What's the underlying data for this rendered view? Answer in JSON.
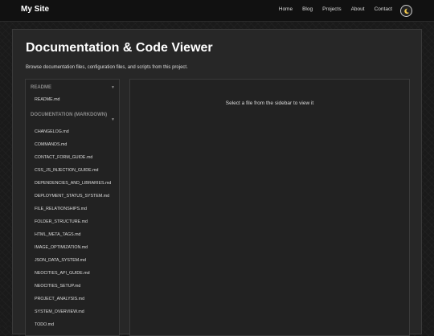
{
  "header": {
    "site_title": "My Site",
    "nav": [
      "Home",
      "Blog",
      "Projects",
      "About",
      "Contact"
    ],
    "theme_icon": "moon-icon"
  },
  "main": {
    "title": "Documentation & Code Viewer",
    "description": "Browse documentation files, configuration files, and scripts from this project."
  },
  "sidebar": {
    "readme_section": {
      "label": "README",
      "files": [
        "README.md"
      ]
    },
    "docs_section": {
      "label": "DOCUMENTATION (MARKDOWN)",
      "files": [
        "CHANGELOG.md",
        "COMMANDS.md",
        "CONTACT_FORM_GUIDE.md",
        "CSS_JS_INJECTION_GUIDE.md",
        "DEPENDENCIES_AND_LIBRARIES.md",
        "DEPLOYMENT_STATUS_SYSTEM.md",
        "FILE_RELATIONSHIPS.md",
        "FOLDER_STRUCTURE.md",
        "HTML_META_TAGS.md",
        "IMAGE_OPTIMIZATION.md",
        "JSON_DATA_SYSTEM.md",
        "NEOCITIES_API_GUIDE.md",
        "NEOCITIES_SETUP.md",
        "PROJECT_ANALYSIS.md",
        "SYSTEM_OVERVIEW.md",
        "TODO.md"
      ]
    }
  },
  "viewer": {
    "placeholder": "Select a file from the sidebar to view it"
  }
}
